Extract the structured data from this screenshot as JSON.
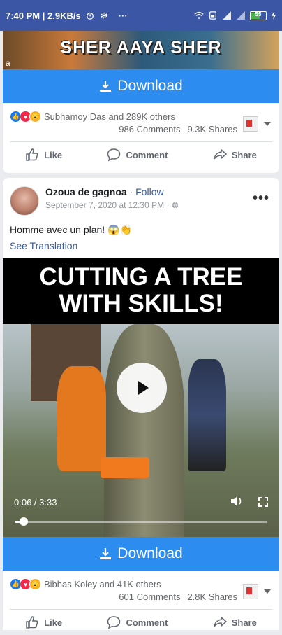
{
  "status_bar": {
    "time_speed": "7:40 PM | 2.9KB/s",
    "more": "···",
    "battery": "55"
  },
  "post1": {
    "thumbnail_caption": "SHER AAYA SHER",
    "thumbnail_corner": "a",
    "download_label": "Download",
    "reactions_text": "Subhamoy Das and 289K others",
    "comments": "986 Comments",
    "shares": "9.3K Shares",
    "actions": {
      "like": "Like",
      "comment": "Comment",
      "share": "Share"
    }
  },
  "post2": {
    "author": "Ozoua de gagnoa",
    "follow": "· Follow",
    "date": "September 7, 2020 at 12:30 PM ·",
    "text": "Homme avec un plan! 😱👏",
    "see_translation": "See Translation",
    "video_title_line1": "CUTTING A TREE",
    "video_title_line2": "WITH SKILLS!",
    "video_time": "0:06 / 3:33",
    "video_progress": 0.03,
    "download_label": "Download",
    "reactions_text": "Bibhas Koley and 41K others",
    "comments": "601 Comments",
    "shares": "2.8K Shares",
    "actions": {
      "like": "Like",
      "comment": "Comment",
      "share": "Share"
    }
  },
  "colors": {
    "status_bar": "#3a56a5",
    "download_button": "#2d8cf0",
    "link": "#385898"
  },
  "icons": [
    "alarm-icon",
    "gear-icon",
    "wifi-icon",
    "signal-icon",
    "battery-icon",
    "download-icon",
    "like-icon",
    "comment-icon",
    "share-icon",
    "play-icon",
    "volume-icon",
    "fullscreen-icon",
    "globe-icon"
  ]
}
